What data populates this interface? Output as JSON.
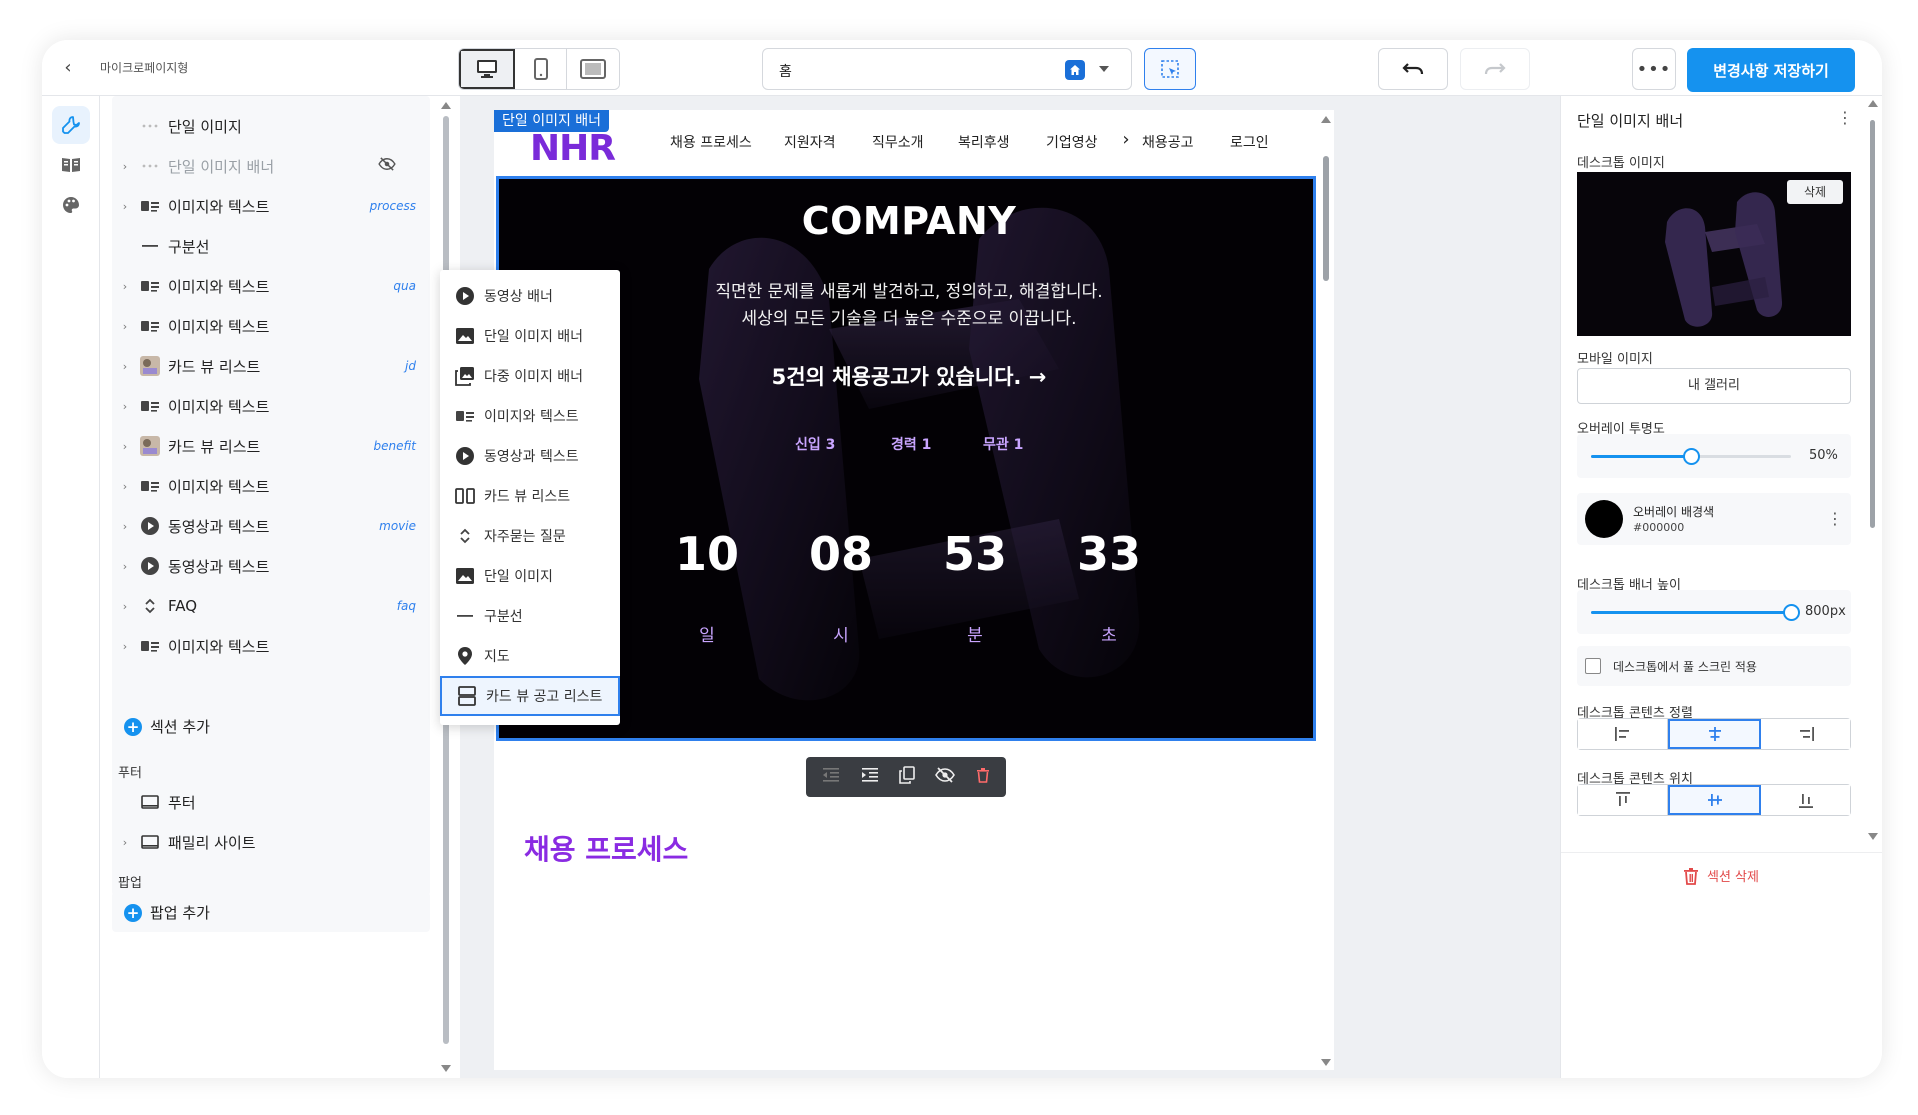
{
  "header": {
    "site_name": "마이크로페이지형",
    "page_select": "홈",
    "save_label": "변경사항 저장하기",
    "more_label": "•••"
  },
  "tree": {
    "items": [
      {
        "label": "단일 이미지",
        "tag": "",
        "icon": "dots-icon",
        "chevron": false,
        "muted": false
      },
      {
        "label": "단일 이미지 배너",
        "tag": "",
        "icon": "dots-icon",
        "chevron": true,
        "muted": true
      },
      {
        "label": "이미지와 텍스트",
        "tag": "process",
        "icon": "image-text-icon",
        "chevron": true,
        "muted": false
      },
      {
        "label": "구분선",
        "tag": "",
        "icon": "divider-icon",
        "chevron": false,
        "muted": false
      },
      {
        "label": "이미지와 텍스트",
        "tag": "qua",
        "icon": "image-text-icon",
        "chevron": true,
        "muted": false
      },
      {
        "label": "이미지와 텍스트",
        "tag": "",
        "icon": "image-text-icon",
        "chevron": true,
        "muted": false
      },
      {
        "label": "카드 뷰 리스트",
        "tag": "jd",
        "icon": "thumbnail-icon",
        "chevron": true,
        "muted": false
      },
      {
        "label": "이미지와 텍스트",
        "tag": "",
        "icon": "image-text-icon",
        "chevron": true,
        "muted": false
      },
      {
        "label": "카드 뷰 리스트",
        "tag": "benefit",
        "icon": "thumbnail-icon",
        "chevron": true,
        "muted": false
      },
      {
        "label": "이미지와 텍스트",
        "tag": "",
        "icon": "image-text-icon",
        "chevron": true,
        "muted": false
      },
      {
        "label": "동영상과 텍스트",
        "tag": "movie",
        "icon": "play-icon",
        "chevron": true,
        "muted": false
      },
      {
        "label": "동영상과 텍스트",
        "tag": "",
        "icon": "play-icon",
        "chevron": true,
        "muted": false
      },
      {
        "label": "FAQ",
        "tag": "faq",
        "icon": "expand-icon",
        "chevron": true,
        "muted": false
      },
      {
        "label": "이미지와 텍스트",
        "tag": "",
        "icon": "image-text-icon",
        "chevron": true,
        "muted": false
      }
    ],
    "add_section": "섹션 추가",
    "footer_title": "푸터",
    "footer_items": [
      "푸터",
      "패밀리 사이트"
    ],
    "popup_title": "팝업",
    "add_popup": "팝업 추가"
  },
  "add_menu": {
    "items": [
      {
        "label": "동영상 배너",
        "icon": "play-circle-icon"
      },
      {
        "label": "단일 이미지 배너",
        "icon": "image-icon"
      },
      {
        "label": "다중 이미지 배너",
        "icon": "images-icon"
      },
      {
        "label": "이미지와 텍스트",
        "icon": "image-text-icon"
      },
      {
        "label": "동영상과 텍스트",
        "icon": "play-circle-icon"
      },
      {
        "label": "카드 뷰 리스트",
        "icon": "card-columns-icon"
      },
      {
        "label": "자주묻는 질문",
        "icon": "expand-icon"
      },
      {
        "label": "단일 이미지",
        "icon": "image-icon"
      },
      {
        "label": "구분선",
        "icon": "divider-icon"
      },
      {
        "label": "지도",
        "icon": "map-pin-icon"
      },
      {
        "label": "카드 뷰 공고 리스트",
        "icon": "card-rows-icon"
      }
    ],
    "selected_index": 10
  },
  "preview_page": {
    "section_badge": "단일 이미지 배너",
    "logo": "NHR",
    "nav": [
      "채용 프로세스",
      "지원자격",
      "직무소개",
      "복리후생",
      "기업영상",
      "채용공고",
      "로그인"
    ],
    "nav_more": "›",
    "banner": {
      "title": "COMPANY",
      "line1": "직면한 문제를 새롭게 발견하고, 정의하고, 해결합니다.",
      "line2": "세상의 모든 기술을 더 높은 수준으로 이끕니다.",
      "cta": "5건의 채용공고가 있습니다. →",
      "counts": [
        "신입 3",
        "경력 1",
        "무관 1"
      ],
      "countdown": [
        {
          "value": "10",
          "unit": "일"
        },
        {
          "value": "08",
          "unit": "시"
        },
        {
          "value": "53",
          "unit": "분"
        },
        {
          "value": "33",
          "unit": "초"
        }
      ]
    },
    "next_section_title": "채용 프로세스"
  },
  "props": {
    "title": "단일 이미지 배너",
    "desktop_image_label": "데스크톱 이미지",
    "delete_chip": "삭제",
    "mobile_image_label": "모바일 이미지",
    "gallery_button": "내 갤러리",
    "overlay_opacity_label": "오버레이 투명도",
    "overlay_opacity_value": "50%",
    "overlay_opacity_fraction": 0.5,
    "overlay_color_label": "오버레이 배경색",
    "overlay_color_hex": "#000000",
    "banner_height_label": "데스크톱 배너 높이",
    "banner_height_value": "800px",
    "banner_height_fraction": 1.0,
    "fullscreen_label": "데스크톱에서 풀 스크린 적용",
    "align_label": "데스크톱 콘텐츠 정렬",
    "align_selected": "center",
    "position_label": "데스크톱 콘텐츠 위치",
    "position_selected": "center",
    "delete_section": "섹션 삭제"
  },
  "colors": {
    "accent": "#1592ef",
    "brand_purple": "#7a2bd9",
    "banner_bg": "#050308",
    "danger": "#e24a4a"
  }
}
